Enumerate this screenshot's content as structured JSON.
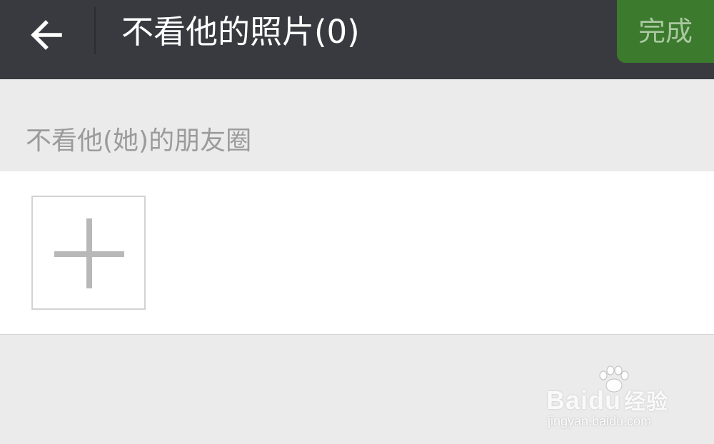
{
  "header": {
    "title": "不看他的照片(0)",
    "done_label": "完成",
    "back_icon": "arrow-left-icon"
  },
  "section": {
    "label": "不看他(她)的朋友圈",
    "add_icon": "plus-icon"
  },
  "watermark": {
    "brand": "Baidu",
    "brand_suffix": "经验",
    "url": "jingyan.baidu.com"
  },
  "colors": {
    "topbar": "#393a3f",
    "done_button": "#3c7a2e",
    "background": "#ebebeb"
  }
}
